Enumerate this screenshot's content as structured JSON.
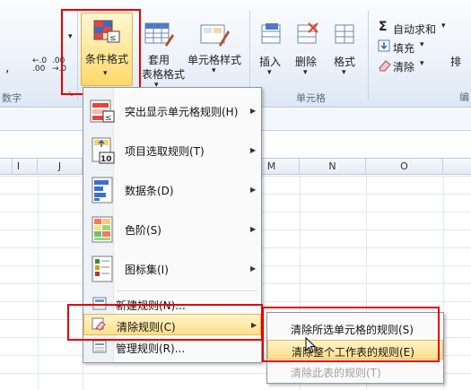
{
  "ribbon": {
    "number_buttons": [
      ",",
      ".00 →.0",
      "→.0 .00"
    ],
    "number_group_label": "数字",
    "conditional_format_label": "条件格式",
    "table_style_label_1": "套用",
    "table_style_label_2": "表格格式",
    "cell_style_label": "单元格样式",
    "insert_label": "插入",
    "delete_label": "删除",
    "format_label": "格式",
    "cells_group_label": "单元格",
    "autosum_label": "自动求和",
    "fill_label": "填充",
    "clear_label": "清除",
    "sort_label": "排",
    "sigma": "Σ"
  },
  "columns": [
    "I",
    "J",
    "M",
    "N",
    "O"
  ],
  "menu": {
    "items": [
      {
        "label": "突出显示单元格规则(H)",
        "icon": "highlight-cells-icon",
        "has_sub": true
      },
      {
        "label": "项目选取规则(T)",
        "icon": "top-bottom-rules-icon",
        "has_sub": true
      },
      {
        "label": "数据条(D)",
        "icon": "data-bars-icon",
        "has_sub": true
      },
      {
        "label": "色阶(S)",
        "icon": "color-scales-icon",
        "has_sub": true
      },
      {
        "label": "图标集(I)",
        "icon": "icon-sets-icon",
        "has_sub": true
      },
      {
        "label": "新建规则(N)...",
        "icon": "new-rule-icon",
        "has_sub": false
      },
      {
        "label": "清除规则(C)",
        "icon": "clear-rules-icon",
        "has_sub": true
      },
      {
        "label": "管理规则(R)...",
        "icon": "manage-rules-icon",
        "has_sub": false
      }
    ]
  },
  "submenu": {
    "items": [
      {
        "label": "清除所选单元格的规则(S)",
        "enabled": true
      },
      {
        "label": "清除整个工作表的规则(E)",
        "enabled": true
      },
      {
        "label": "清除此表的规则(T)",
        "enabled": false
      }
    ]
  },
  "colors": {
    "highlight_box": "#e60000",
    "menu_hover": "#ffe08a",
    "ribbon_bg": "#eef3fa"
  }
}
